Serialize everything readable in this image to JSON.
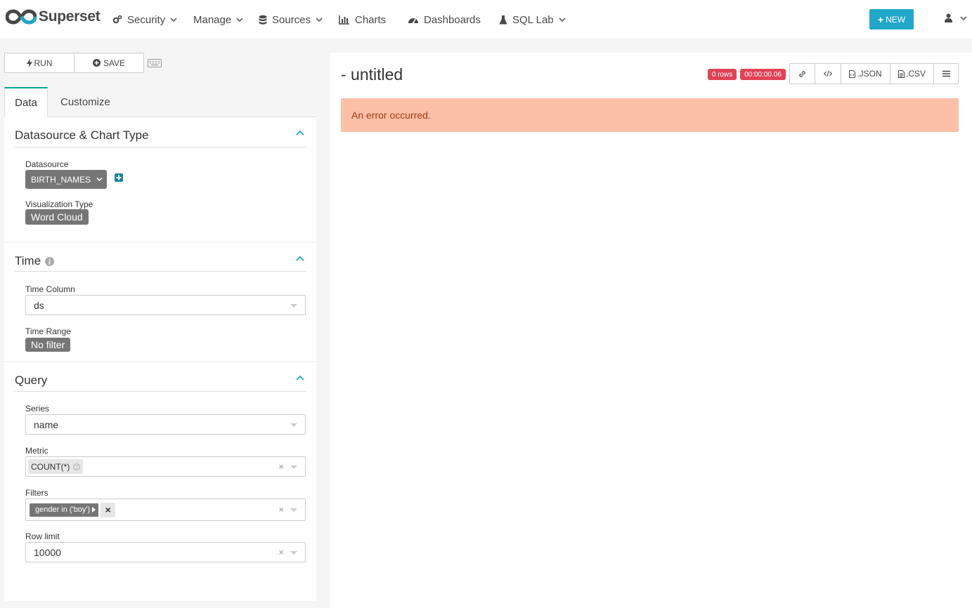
{
  "brand": {
    "name": "Superset"
  },
  "nav": {
    "security": "Security",
    "manage": "Manage",
    "sources": "Sources",
    "charts": "Charts",
    "dashboards": "Dashboards",
    "sql_lab": "SQL Lab",
    "new_button": "NEW"
  },
  "toolbar": {
    "run": "RUN",
    "save": "SAVE"
  },
  "tabs": {
    "data": "Data",
    "customize": "Customize"
  },
  "sections": {
    "datasource": {
      "title": "Datasource & Chart Type",
      "datasource_label": "Datasource",
      "datasource_value": "BIRTH_NAMES",
      "viz_label": "Visualization Type",
      "viz_value": "Word Cloud"
    },
    "time": {
      "title": "Time",
      "time_column_label": "Time Column",
      "time_column_value": "ds",
      "time_range_label": "Time Range",
      "time_range_value": "No filter"
    },
    "query": {
      "title": "Query",
      "series_label": "Series",
      "series_value": "name",
      "metric_label": "Metric",
      "metric_value": "COUNT(*)",
      "filters_label": "Filters",
      "filter_value": "gender in ('boy')",
      "row_limit_label": "Row limit",
      "row_limit_value": "10000"
    }
  },
  "chart": {
    "title": "- untitled",
    "rows_badge": "0 rows",
    "time_badge": "00:00:00.06",
    "json_button": ".JSON",
    "csv_button": ".CSV",
    "error": "An error occurred."
  },
  "colors": {
    "accent": "#20a7c9",
    "teal": "#00a699",
    "badge_red": "#e04355",
    "alert_bg": "#fcbfa8",
    "alert_text": "#a33a13"
  }
}
